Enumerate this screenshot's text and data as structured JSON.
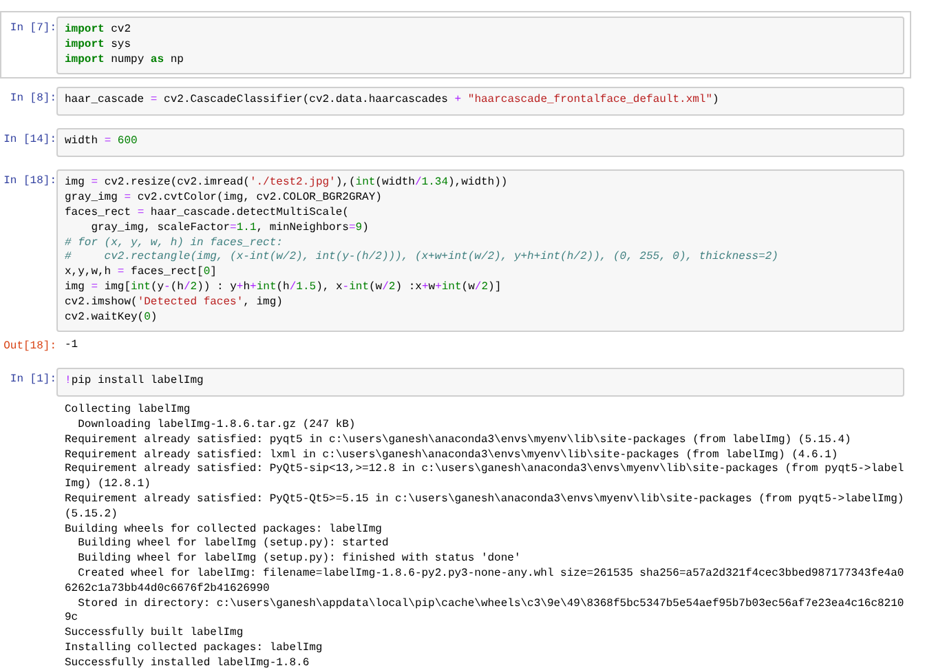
{
  "cells": [
    {
      "prompt": "In [7]:",
      "selected": true,
      "code": [
        [
          {
            "kind": "keyword",
            "text": "import"
          },
          {
            "kind": "plain",
            "text": " cv2"
          }
        ],
        [
          {
            "kind": "keyword",
            "text": "import"
          },
          {
            "kind": "plain",
            "text": " sys"
          }
        ],
        [
          {
            "kind": "keyword",
            "text": "import"
          },
          {
            "kind": "plain",
            "text": " numpy "
          },
          {
            "kind": "keyword",
            "text": "as"
          },
          {
            "kind": "plain",
            "text": " np"
          }
        ]
      ]
    },
    {
      "prompt": "In [8]:",
      "selected": false,
      "code": [
        [
          {
            "kind": "plain",
            "text": "haar_cascade "
          },
          {
            "kind": "operator",
            "text": "="
          },
          {
            "kind": "plain",
            "text": " cv2.CascadeClassifier(cv2.data.haarcascades "
          },
          {
            "kind": "operator",
            "text": "+ "
          },
          {
            "kind": "string",
            "text": "\"haarcascade_frontalface_default.xml\""
          },
          {
            "kind": "plain",
            "text": ")"
          }
        ]
      ]
    },
    {
      "prompt": "In [14]:",
      "selected": false,
      "code": [
        [
          {
            "kind": "plain",
            "text": "width "
          },
          {
            "kind": "operator",
            "text": "= "
          },
          {
            "kind": "number",
            "text": "600"
          }
        ]
      ]
    },
    {
      "prompt": "In [18]:",
      "selected": false,
      "code": [
        [
          {
            "kind": "plain",
            "text": "img "
          },
          {
            "kind": "operator",
            "text": "="
          },
          {
            "kind": "plain",
            "text": " cv2.resize(cv2.imread("
          },
          {
            "kind": "string",
            "text": "'./test2.jpg'"
          },
          {
            "kind": "plain",
            "text": "),("
          },
          {
            "kind": "builtin",
            "text": "int"
          },
          {
            "kind": "plain",
            "text": "(width"
          },
          {
            "kind": "operator",
            "text": "/"
          },
          {
            "kind": "number",
            "text": "1.34"
          },
          {
            "kind": "plain",
            "text": "),width))"
          }
        ],
        [
          {
            "kind": "plain",
            "text": "gray_img "
          },
          {
            "kind": "operator",
            "text": "="
          },
          {
            "kind": "plain",
            "text": " cv2.cvtColor(img, cv2.COLOR_BGR2GRAY)"
          }
        ],
        [
          {
            "kind": "plain",
            "text": "faces_rect "
          },
          {
            "kind": "operator",
            "text": "="
          },
          {
            "kind": "plain",
            "text": " haar_cascade.detectMultiScale("
          }
        ],
        [
          {
            "kind": "plain",
            "text": "    gray_img, scaleFactor"
          },
          {
            "kind": "operator",
            "text": "="
          },
          {
            "kind": "number",
            "text": "1.1"
          },
          {
            "kind": "plain",
            "text": ", minNeighbors"
          },
          {
            "kind": "operator",
            "text": "="
          },
          {
            "kind": "number",
            "text": "9"
          },
          {
            "kind": "plain",
            "text": ")"
          }
        ],
        [
          {
            "kind": "comment",
            "text": "# for (x, y, w, h) in faces_rect:"
          }
        ],
        [
          {
            "kind": "comment",
            "text": "#     cv2.rectangle(img, (x-int(w/2), int(y-(h/2))), (x+w+int(w/2), y+h+int(h/2)), (0, 255, 0), thickness=2)"
          }
        ],
        [
          {
            "kind": "plain",
            "text": "x,y,w,h "
          },
          {
            "kind": "operator",
            "text": "="
          },
          {
            "kind": "plain",
            "text": " faces_rect["
          },
          {
            "kind": "number",
            "text": "0"
          },
          {
            "kind": "plain",
            "text": "]"
          }
        ],
        [
          {
            "kind": "plain",
            "text": "img "
          },
          {
            "kind": "operator",
            "text": "="
          },
          {
            "kind": "plain",
            "text": " img["
          },
          {
            "kind": "builtin",
            "text": "int"
          },
          {
            "kind": "plain",
            "text": "(y"
          },
          {
            "kind": "operator",
            "text": "-"
          },
          {
            "kind": "plain",
            "text": "(h"
          },
          {
            "kind": "operator",
            "text": "/"
          },
          {
            "kind": "number",
            "text": "2"
          },
          {
            "kind": "plain",
            "text": ")) : y"
          },
          {
            "kind": "operator",
            "text": "+"
          },
          {
            "kind": "plain",
            "text": "h"
          },
          {
            "kind": "operator",
            "text": "+"
          },
          {
            "kind": "builtin",
            "text": "int"
          },
          {
            "kind": "plain",
            "text": "(h"
          },
          {
            "kind": "operator",
            "text": "/"
          },
          {
            "kind": "number",
            "text": "1.5"
          },
          {
            "kind": "plain",
            "text": "), x"
          },
          {
            "kind": "operator",
            "text": "-"
          },
          {
            "kind": "builtin",
            "text": "int"
          },
          {
            "kind": "plain",
            "text": "(w"
          },
          {
            "kind": "operator",
            "text": "/"
          },
          {
            "kind": "number",
            "text": "2"
          },
          {
            "kind": "plain",
            "text": ") :x"
          },
          {
            "kind": "operator",
            "text": "+"
          },
          {
            "kind": "plain",
            "text": "w"
          },
          {
            "kind": "operator",
            "text": "+"
          },
          {
            "kind": "builtin",
            "text": "int"
          },
          {
            "kind": "plain",
            "text": "(w"
          },
          {
            "kind": "operator",
            "text": "/"
          },
          {
            "kind": "number",
            "text": "2"
          },
          {
            "kind": "plain",
            "text": ")]"
          }
        ],
        [
          {
            "kind": "plain",
            "text": "cv2.imshow("
          },
          {
            "kind": "string",
            "text": "'Detected faces'"
          },
          {
            "kind": "plain",
            "text": ", img)"
          }
        ],
        [
          {
            "kind": "plain",
            "text": "cv2.waitKey("
          },
          {
            "kind": "number",
            "text": "0"
          },
          {
            "kind": "plain",
            "text": ")"
          }
        ]
      ],
      "out_prompt": "Out[18]:",
      "output": [
        "-1"
      ]
    },
    {
      "prompt": "In [1]:",
      "selected": false,
      "code": [
        [
          {
            "kind": "operator",
            "text": "!"
          },
          {
            "kind": "plain",
            "text": "pip install labelImg"
          }
        ]
      ],
      "output": [
        "Collecting labelImg",
        "  Downloading labelImg-1.8.6.tar.gz (247 kB)",
        "Requirement already satisfied: pyqt5 in c:\\users\\ganesh\\anaconda3\\envs\\myenv\\lib\\site-packages (from labelImg) (5.15.4)",
        "Requirement already satisfied: lxml in c:\\users\\ganesh\\anaconda3\\envs\\myenv\\lib\\site-packages (from labelImg) (4.6.1)",
        "Requirement already satisfied: PyQt5-sip<13,>=12.8 in c:\\users\\ganesh\\anaconda3\\envs\\myenv\\lib\\site-packages (from pyqt5->label",
        "Img) (12.8.1)",
        "Requirement already satisfied: PyQt5-Qt5>=5.15 in c:\\users\\ganesh\\anaconda3\\envs\\myenv\\lib\\site-packages (from pyqt5->labelImg)",
        "(5.15.2)",
        "Building wheels for collected packages: labelImg",
        "  Building wheel for labelImg (setup.py): started",
        "  Building wheel for labelImg (setup.py): finished with status 'done'",
        "  Created wheel for labelImg: filename=labelImg-1.8.6-py2.py3-none-any.whl size=261535 sha256=a57a2d321f4cec3bbed987177343fe4a0",
        "6262c1a73bb44d0c6676f2b41626990",
        "  Stored in directory: c:\\users\\ganesh\\appdata\\local\\pip\\cache\\wheels\\c3\\9e\\49\\8368f5bc5347b5e54aef95b7b03ec56af7e23ea4c16c8210",
        "9c",
        "Successfully built labelImg",
        "Installing collected packages: labelImg",
        "Successfully installed labelImg-1.8.6"
      ]
    }
  ]
}
